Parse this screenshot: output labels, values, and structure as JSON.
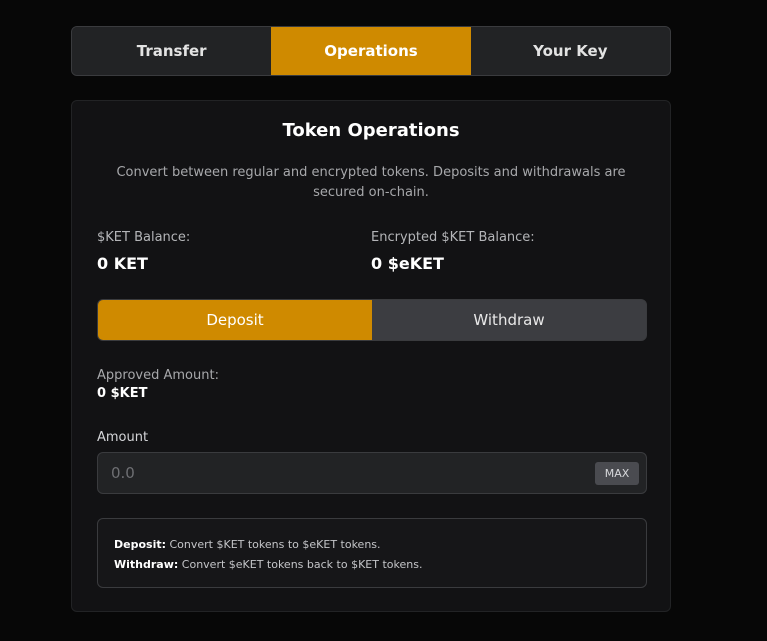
{
  "tabs": [
    {
      "label": "Transfer",
      "active": false
    },
    {
      "label": "Operations",
      "active": true
    },
    {
      "label": "Your Key",
      "active": false
    }
  ],
  "card": {
    "title": "Token Operations",
    "description": "Convert between regular and encrypted tokens. Deposits and withdrawals are secured on-chain."
  },
  "balances": {
    "ket_label": "$KET Balance:",
    "ket_value": "0 KET",
    "eket_label": "Encrypted $KET Balance:",
    "eket_value": "0 $eKET"
  },
  "mode": {
    "deposit_label": "Deposit",
    "withdraw_label": "Withdraw",
    "active": "deposit"
  },
  "approved": {
    "label": "Approved Amount:",
    "value": "0 $KET"
  },
  "amount": {
    "label": "Amount",
    "placeholder": "0.0",
    "value": "",
    "max_label": "MAX"
  },
  "info": {
    "deposit_term": "Deposit:",
    "deposit_text": " Convert $KET tokens to $eKET tokens.",
    "withdraw_term": "Withdraw:",
    "withdraw_text": " Convert $eKET tokens back to $KET tokens."
  },
  "colors": {
    "accent": "#cf8a00",
    "background": "#070707",
    "card": "#121214"
  }
}
